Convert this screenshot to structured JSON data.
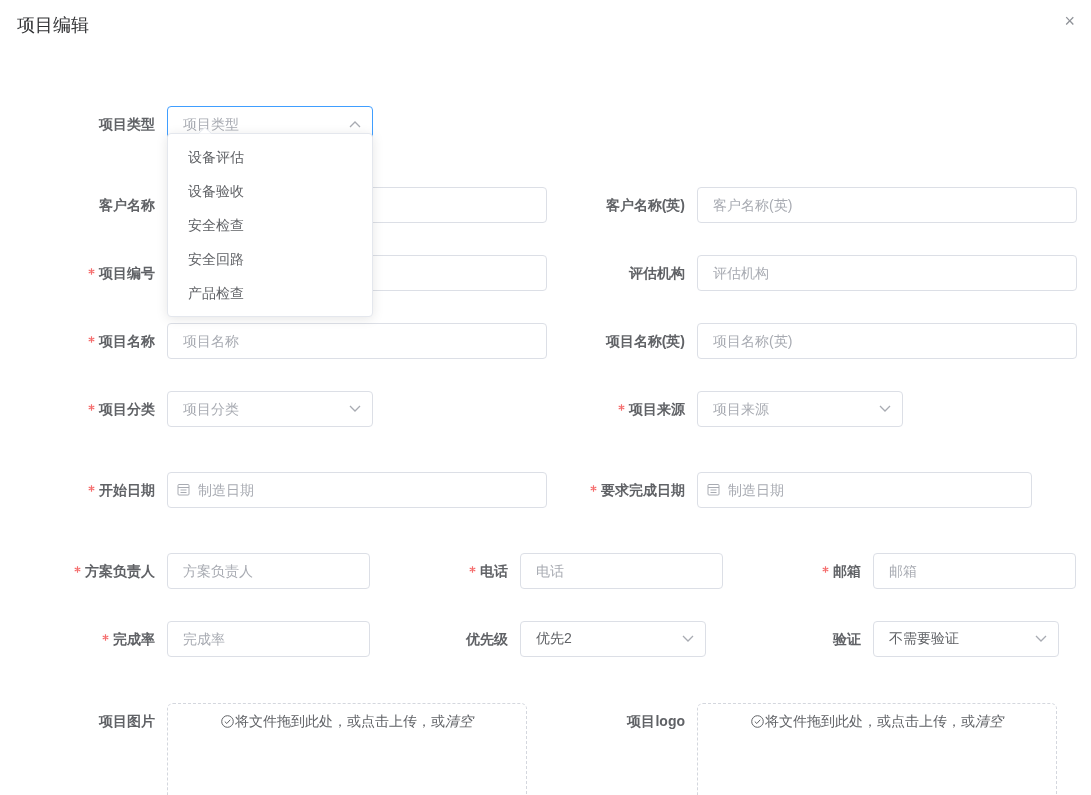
{
  "dialog": {
    "title": "项目编辑",
    "close": "×"
  },
  "rows": [
    {
      "fields": [
        {
          "kind": "select",
          "label": "项目类型",
          "required": false,
          "placeholder": "项目类型",
          "expanded": true,
          "options": [
            {
              "label": "设备评估",
              "selected": false
            },
            {
              "label": "设备验收",
              "selected": false
            },
            {
              "label": "安全检查",
              "selected": false
            },
            {
              "label": "安全回路",
              "selected": false
            },
            {
              "label": "产品检查",
              "selected": false
            }
          ]
        }
      ]
    },
    {
      "fields": [
        {
          "kind": "input",
          "label": "客户名称",
          "required": false
        },
        {
          "kind": "input",
          "label": "客户名称(英)",
          "required": false,
          "placeholder": "客户名称(英)"
        }
      ]
    },
    {
      "fields": [
        {
          "kind": "input",
          "label": "项目编号",
          "required": true
        },
        {
          "kind": "input",
          "label": "评估机构",
          "required": false,
          "placeholder": "评估机构"
        }
      ]
    },
    {
      "fields": [
        {
          "kind": "input",
          "label": "项目名称",
          "required": true,
          "placeholder": "项目名称"
        },
        {
          "kind": "input",
          "label": "项目名称(英)",
          "required": false,
          "placeholder": "项目名称(英)"
        }
      ]
    },
    {
      "fields": [
        {
          "kind": "select",
          "label": "项目分类",
          "required": true,
          "placeholder": "项目分类",
          "expanded": false
        },
        {
          "kind": "select",
          "label": "项目来源",
          "required": true,
          "placeholder": "项目来源",
          "expanded": false
        }
      ]
    },
    {
      "fields": [
        {
          "kind": "date",
          "label": "开始日期",
          "required": true,
          "placeholder": "制造日期"
        },
        {
          "kind": "date",
          "label": "要求完成日期",
          "required": true,
          "placeholder": "制造日期"
        }
      ]
    },
    {
      "fields": [
        {
          "kind": "input",
          "label": "方案负责人",
          "required": true,
          "placeholder": "方案负责人"
        },
        {
          "kind": "input",
          "label": "电话",
          "required": true,
          "placeholder": "电话"
        },
        {
          "kind": "input",
          "label": "邮箱",
          "required": true,
          "placeholder": "邮箱"
        }
      ]
    },
    {
      "fields": [
        {
          "kind": "input",
          "label": "完成率",
          "required": true,
          "placeholder": "完成率"
        },
        {
          "kind": "select",
          "label": "优先级",
          "required": false,
          "value": "优先2",
          "expanded": false
        },
        {
          "kind": "select",
          "label": "验证",
          "required": false,
          "value": "不需要验证",
          "expanded": false
        }
      ]
    },
    {
      "fields": [
        {
          "kind": "upload",
          "label": "项目图片",
          "required": false,
          "text": "将文件拖到此处，或点击上传，或",
          "link": "清空"
        },
        {
          "kind": "upload",
          "label": "项目logo",
          "required": false,
          "text": "将文件拖到此处，或点击上传，或",
          "link": "清空"
        }
      ]
    }
  ]
}
